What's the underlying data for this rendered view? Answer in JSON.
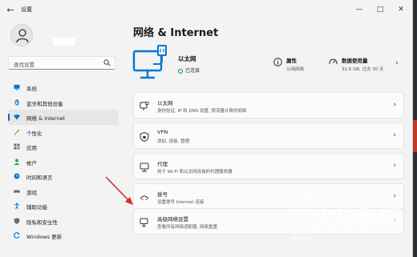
{
  "window": {
    "title": "设置",
    "back_icon": "back-arrow-icon",
    "controls": [
      "minimize-icon",
      "maximize-icon",
      "close-icon"
    ]
  },
  "search": {
    "placeholder": "查找设置",
    "icon": "search-icon"
  },
  "sidebar": {
    "items": [
      {
        "label": "系统",
        "icon": "monitor-icon",
        "color": "#0078d4"
      },
      {
        "label": "蓝牙和其他设备",
        "icon": "bluetooth-icon",
        "color": "#0078d4"
      },
      {
        "label": "网络 & Internet",
        "icon": "wifi-icon",
        "color": "#0078d4",
        "active": true
      },
      {
        "label": "个性化",
        "icon": "brush-icon",
        "color": "#e08a2c"
      },
      {
        "label": "应用",
        "icon": "apps-icon",
        "color": "#6b6b6b"
      },
      {
        "label": "帐户",
        "icon": "account-icon",
        "color": "#2ea05a"
      },
      {
        "label": "时间和语言",
        "icon": "clock-globe-icon",
        "color": "#0078d4"
      },
      {
        "label": "游戏",
        "icon": "gamepad-icon",
        "color": "#6b6b6b"
      },
      {
        "label": "辅助功能",
        "icon": "accessibility-icon",
        "color": "#0078d4"
      },
      {
        "label": "隐私和安全性",
        "icon": "shield-icon",
        "color": "#6b6b6b"
      },
      {
        "label": "Windows 更新",
        "icon": "update-icon",
        "color": "#0078d4"
      }
    ]
  },
  "main": {
    "title": "网络 & Internet",
    "hero": {
      "name": "以太网",
      "status": "已连接",
      "icon": "ethernet-monitor-icon",
      "properties": {
        "title": "属性",
        "subtitle": "公用网络",
        "icon": "info-icon"
      },
      "data_usage": {
        "title": "数据使用量",
        "subtitle": "32.6 GB, 过去 30 天",
        "icon": "gauge-icon"
      }
    },
    "cards": [
      {
        "title": "以太网",
        "subtitle": "身份验证, IP 和 DNS 设置, 按流量计费的网络",
        "icon": "ethernet-icon"
      },
      {
        "title": "VPN",
        "subtitle": "添加, 连接, 管理",
        "icon": "vpn-shield-icon"
      },
      {
        "title": "代理",
        "subtitle": "用于 Wi-Fi 和以太网连接的代理服务器",
        "icon": "proxy-icon"
      },
      {
        "title": "拨号",
        "subtitle": "设置拨号 Internet 连接",
        "icon": "dialup-icon"
      },
      {
        "title": "高级网络设置",
        "subtitle": "查看所有网络适配器, 网络重置",
        "icon": "advanced-network-icon"
      }
    ]
  },
  "watermark": {
    "cn": "大地系统",
    "en": "DadiGhost.com"
  },
  "colors": {
    "accent": "#0067c0",
    "annotation": "#d9272e",
    "hero_icon": "#0078d4"
  }
}
